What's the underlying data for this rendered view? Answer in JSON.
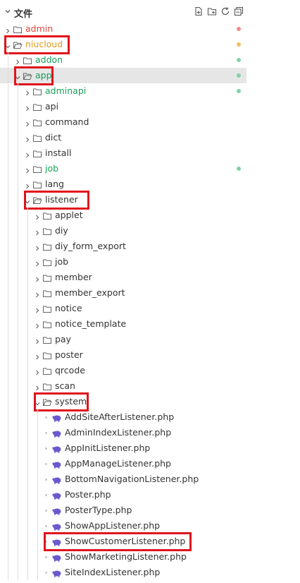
{
  "explorer": {
    "title": "文件",
    "tools": [
      "new-file-icon",
      "new-folder-icon",
      "refresh-icon",
      "collapse-all-icon"
    ]
  },
  "colors": {
    "default_text": "#333333",
    "untracked_green": "#18a058",
    "modified_orange": "#e39a1a",
    "deleted_red": "#e0453a",
    "highlight_box": "#e0141c",
    "php_icon": "#6a5acd",
    "selected_bg": "#e6e6e6"
  },
  "tree": [
    {
      "label": "admin",
      "depth": 0,
      "kind": "folder",
      "expanded": false,
      "status": "red",
      "highlight": false,
      "selected": false
    },
    {
      "label": "niucloud",
      "depth": 0,
      "kind": "folder",
      "expanded": true,
      "status": "orange",
      "highlight": true,
      "selected": false
    },
    {
      "label": "addon",
      "depth": 1,
      "kind": "folder",
      "expanded": false,
      "status": "green",
      "highlight": false,
      "selected": false
    },
    {
      "label": "app",
      "depth": 1,
      "kind": "folder",
      "expanded": true,
      "status": "green",
      "highlight": true,
      "selected": true
    },
    {
      "label": "adminapi",
      "depth": 2,
      "kind": "folder",
      "expanded": false,
      "status": "green",
      "highlight": false,
      "selected": false
    },
    {
      "label": "api",
      "depth": 2,
      "kind": "folder",
      "expanded": false,
      "status": "",
      "highlight": false,
      "selected": false
    },
    {
      "label": "command",
      "depth": 2,
      "kind": "folder",
      "expanded": false,
      "status": "",
      "highlight": false,
      "selected": false
    },
    {
      "label": "dict",
      "depth": 2,
      "kind": "folder",
      "expanded": false,
      "status": "",
      "highlight": false,
      "selected": false
    },
    {
      "label": "install",
      "depth": 2,
      "kind": "folder",
      "expanded": false,
      "status": "",
      "highlight": false,
      "selected": false
    },
    {
      "label": "job",
      "depth": 2,
      "kind": "folder",
      "expanded": false,
      "status": "green",
      "highlight": false,
      "selected": false
    },
    {
      "label": "lang",
      "depth": 2,
      "kind": "folder",
      "expanded": false,
      "status": "",
      "highlight": false,
      "selected": false
    },
    {
      "label": "listener",
      "depth": 2,
      "kind": "folder",
      "expanded": true,
      "status": "",
      "highlight": true,
      "selected": false
    },
    {
      "label": "applet",
      "depth": 3,
      "kind": "folder",
      "expanded": false,
      "status": "",
      "highlight": false,
      "selected": false
    },
    {
      "label": "diy",
      "depth": 3,
      "kind": "folder",
      "expanded": false,
      "status": "",
      "highlight": false,
      "selected": false
    },
    {
      "label": "diy_form_export",
      "depth": 3,
      "kind": "folder",
      "expanded": false,
      "status": "",
      "highlight": false,
      "selected": false
    },
    {
      "label": "job",
      "depth": 3,
      "kind": "folder",
      "expanded": false,
      "status": "",
      "highlight": false,
      "selected": false
    },
    {
      "label": "member",
      "depth": 3,
      "kind": "folder",
      "expanded": false,
      "status": "",
      "highlight": false,
      "selected": false
    },
    {
      "label": "member_export",
      "depth": 3,
      "kind": "folder",
      "expanded": false,
      "status": "",
      "highlight": false,
      "selected": false
    },
    {
      "label": "notice",
      "depth": 3,
      "kind": "folder",
      "expanded": false,
      "status": "",
      "highlight": false,
      "selected": false
    },
    {
      "label": "notice_template",
      "depth": 3,
      "kind": "folder",
      "expanded": false,
      "status": "",
      "highlight": false,
      "selected": false
    },
    {
      "label": "pay",
      "depth": 3,
      "kind": "folder",
      "expanded": false,
      "status": "",
      "highlight": false,
      "selected": false
    },
    {
      "label": "poster",
      "depth": 3,
      "kind": "folder",
      "expanded": false,
      "status": "",
      "highlight": false,
      "selected": false
    },
    {
      "label": "qrcode",
      "depth": 3,
      "kind": "folder",
      "expanded": false,
      "status": "",
      "highlight": false,
      "selected": false
    },
    {
      "label": "scan",
      "depth": 3,
      "kind": "folder",
      "expanded": false,
      "status": "",
      "highlight": false,
      "selected": false
    },
    {
      "label": "system",
      "depth": 3,
      "kind": "folder",
      "expanded": true,
      "status": "",
      "highlight": true,
      "selected": false
    },
    {
      "label": "AddSiteAfterListener.php",
      "depth": 4,
      "kind": "php",
      "status": "",
      "highlight": false,
      "selected": false
    },
    {
      "label": "AdminIndexListener.php",
      "depth": 4,
      "kind": "php",
      "status": "",
      "highlight": false,
      "selected": false
    },
    {
      "label": "AppInitListener.php",
      "depth": 4,
      "kind": "php",
      "status": "",
      "highlight": false,
      "selected": false
    },
    {
      "label": "AppManageListener.php",
      "depth": 4,
      "kind": "php",
      "status": "",
      "highlight": false,
      "selected": false
    },
    {
      "label": "BottomNavigationListener.php",
      "depth": 4,
      "kind": "php",
      "status": "",
      "highlight": false,
      "selected": false
    },
    {
      "label": "Poster.php",
      "depth": 4,
      "kind": "php",
      "status": "",
      "highlight": false,
      "selected": false
    },
    {
      "label": "PosterType.php",
      "depth": 4,
      "kind": "php",
      "status": "",
      "highlight": false,
      "selected": false
    },
    {
      "label": "ShowAppListener.php",
      "depth": 4,
      "kind": "php",
      "status": "",
      "highlight": false,
      "selected": false
    },
    {
      "label": "ShowCustomerListener.php",
      "depth": 4,
      "kind": "php",
      "status": "",
      "highlight": true,
      "selected": false
    },
    {
      "label": "ShowMarketingListener.php",
      "depth": 4,
      "kind": "php",
      "status": "",
      "highlight": false,
      "selected": false
    },
    {
      "label": "SiteIndexListener.php",
      "depth": 4,
      "kind": "php",
      "status": "",
      "highlight": false,
      "selected": false
    }
  ]
}
